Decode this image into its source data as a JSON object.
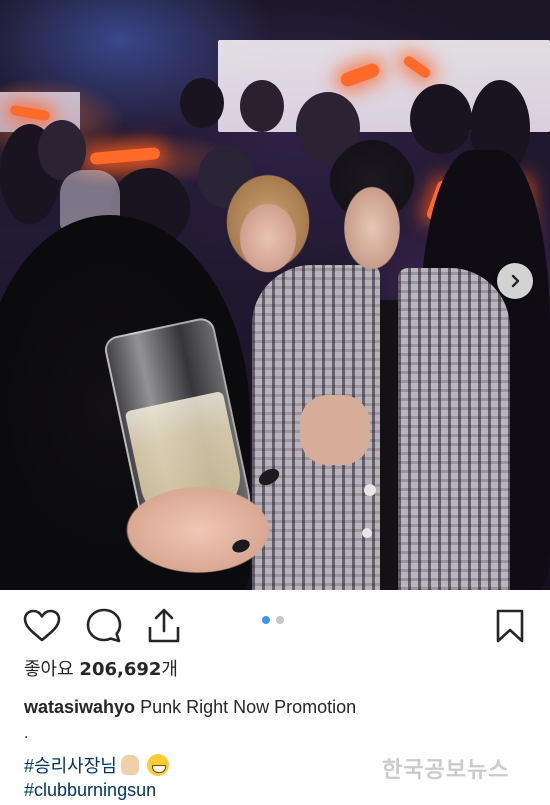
{
  "post": {
    "likes_label": "좋아요",
    "likes_count": "206,692",
    "likes_suffix": "개",
    "username": "watasiwahyo",
    "caption": "Punk Right Now Promotion",
    "caption_dot": ".",
    "hashtags": [
      "#승리사장님",
      "#clubburningsun"
    ],
    "carousel": {
      "total": 2,
      "current": 1
    }
  },
  "icons": {
    "like": "heart-icon",
    "comment": "comment-bubble-icon",
    "share": "share-upload-icon",
    "save": "bookmark-icon",
    "next": "chevron-right-icon"
  },
  "colors": {
    "accent": "#3897f0",
    "hashtag": "#003569",
    "text": "#262626"
  },
  "watermark": "한국공보뉴스"
}
